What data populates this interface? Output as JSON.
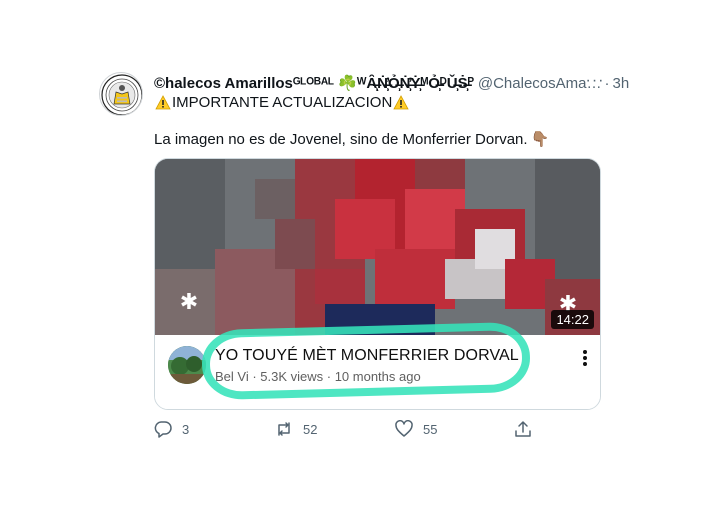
{
  "tweet": {
    "display_name": "©halecos Amarillosᴳᴸᴼᴮᴬᴸ ☘️ᵂȂ̶̩̹ͅṄ̶̩̹̓Ỏ̶̩̹Ṅ̶̩̹̓Ẏ̶̩̹ᴹỎ̶̩̹ᴰǓ̶̩̹Ṡ̶̩̹ᴾ",
    "handle": "@ChalecosAma…",
    "separator": "·",
    "time": "3h",
    "more_label": "···",
    "line2_text": "IMPORTANTE ACTUALIZACION",
    "body_text": "La imagen no es de Jovenel, sino de Monferrier Dorvan.",
    "hand_emoji": "👇🏽"
  },
  "video_card": {
    "duration": "14:22",
    "title": "YO TOUYÉ MÈT MONFERRIER DORVAL",
    "meta": "Bel Vi · 5.3K views · 10 months ago",
    "highlight_color": "#35e3b9"
  },
  "actions": {
    "reply_count": "3",
    "retweet_count": "52",
    "like_count": "55"
  },
  "colors": {
    "text_primary": "#0f1419",
    "text_secondary": "#536471",
    "yellow_vest": "#f3c61a"
  }
}
